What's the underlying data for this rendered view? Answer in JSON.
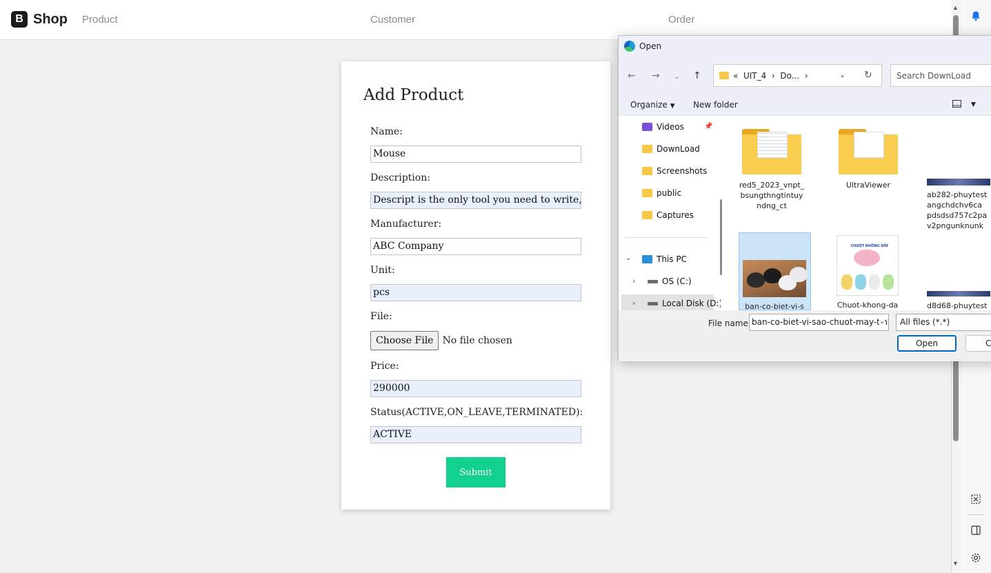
{
  "navbar": {
    "brand_letter": "B",
    "brand_text": "Shop",
    "links": [
      "Product",
      "Customer",
      "Order"
    ]
  },
  "form": {
    "title": "Add Product",
    "fields": {
      "name": {
        "label": "Name:",
        "value": "Mouse"
      },
      "description": {
        "label": "Description:",
        "value": "Descript is the only tool you need to write, r"
      },
      "manufacturer": {
        "label": "Manufacturer:",
        "value": "ABC Company"
      },
      "unit": {
        "label": "Unit:",
        "value": "pcs"
      },
      "file": {
        "label": "File:",
        "button": "Choose File",
        "status": "No file chosen"
      },
      "price": {
        "label": "Price:",
        "value": "290000"
      },
      "status": {
        "label": "Status(ACTIVE,ON_LEAVE,TERMINATED):",
        "value": "ACTIVE"
      }
    },
    "submit_label": "Submit"
  },
  "dialog": {
    "title": "Open",
    "address": {
      "prefix": "«",
      "crumbs": [
        "UIT_4",
        "Do...",
        ""
      ]
    },
    "search_placeholder": "Search DownLoad",
    "toolbar": {
      "organize": "Organize",
      "new_folder": "New folder"
    },
    "nav_items": [
      {
        "label": "Videos",
        "icon": "video-folder-icon",
        "pinned": true
      },
      {
        "label": "DownLoad",
        "icon": "folder-icon"
      },
      {
        "label": "Screenshots",
        "icon": "folder-icon"
      },
      {
        "label": "public",
        "icon": "folder-icon"
      },
      {
        "label": "Captures",
        "icon": "folder-icon"
      },
      {
        "label": "This PC",
        "icon": "pc-icon"
      },
      {
        "label": "OS (C:)",
        "icon": "drive-icon"
      },
      {
        "label": "Local Disk (D:)",
        "icon": "drive-icon"
      }
    ],
    "files": [
      {
        "name": "red5_2023_vnpt_\nbsungthngtintuy\nndng_ct",
        "type": "folder"
      },
      {
        "name": "UltraViewer",
        "type": "folder"
      },
      {
        "name": "ab282-phuytest\nangchdchv6ca\npdsdsd757c2pa\nv2pngunknunk",
        "type": "image"
      },
      {
        "name": "ban-co-biet-vi-s",
        "type": "image",
        "selected": true
      },
      {
        "name": "Chuot-khong-da",
        "type": "image"
      },
      {
        "name": "d8d68-phuytest",
        "type": "image"
      }
    ],
    "file_name_label": "File name:",
    "file_name_value": "ban-co-biet-vi-sao-chuot-may-tinh",
    "file_type": "All files (*.*)",
    "open_label": "Open",
    "cancel_label": "Ca",
    "product_box_text": "CHUỘT KHÔNG DÂY WIRELESS"
  }
}
